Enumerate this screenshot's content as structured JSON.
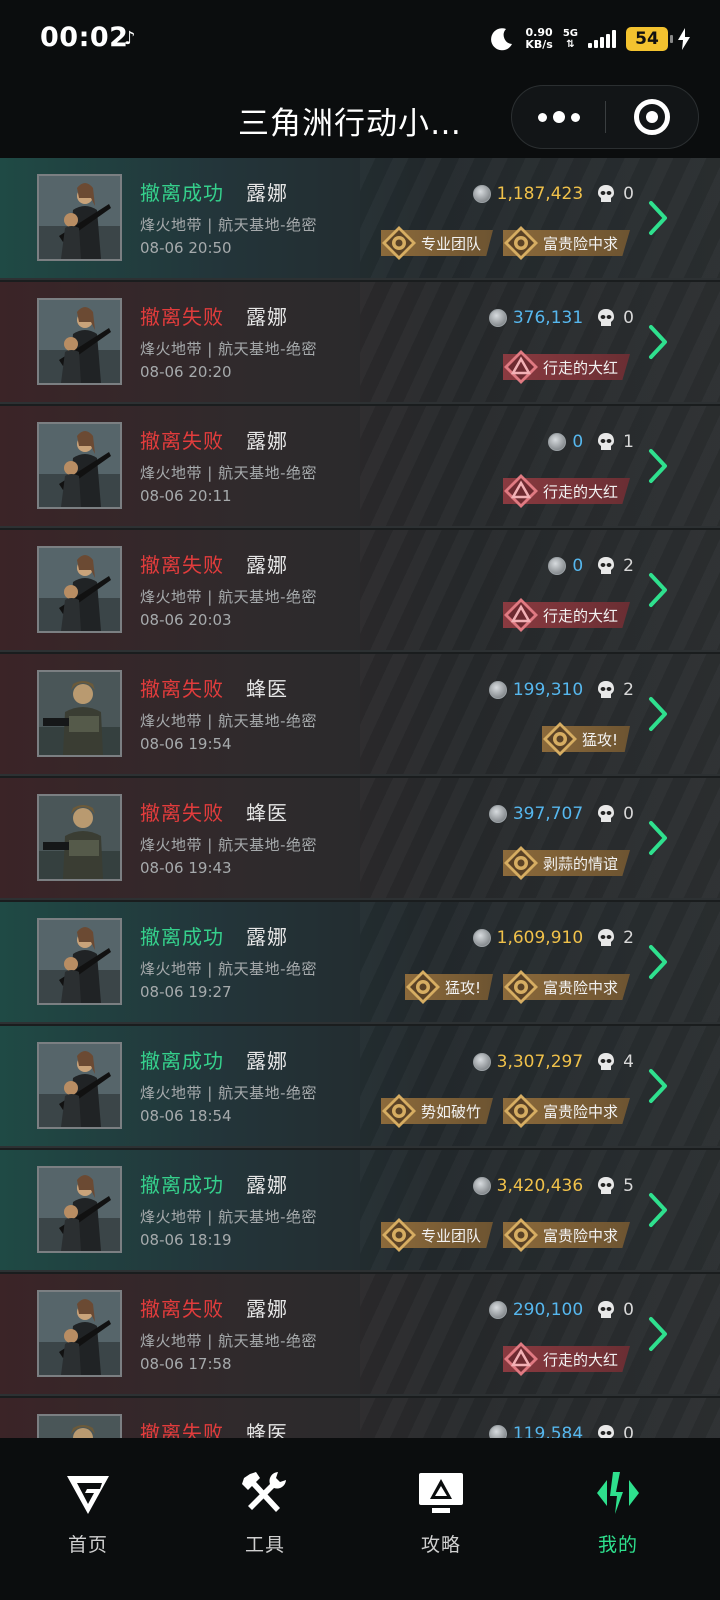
{
  "status_bar": {
    "time": "00:02",
    "speed_value": "0.90",
    "speed_unit": "KB/s",
    "network": "5G",
    "battery": "54"
  },
  "header": {
    "title": "三角洲行动小…"
  },
  "records": [
    {
      "result": "撤离成功",
      "result_type": "success",
      "character": "露娜",
      "avatar": "luna-avatar",
      "map": "烽火地带 | 航天基地-绝密",
      "time": "08-06 20:50",
      "value": "1,187,423",
      "value_color": "gold",
      "kills": "0",
      "tags": [
        {
          "label": "专业团队",
          "style": "gold"
        },
        {
          "label": "富贵险中求",
          "style": "gold"
        }
      ]
    },
    {
      "result": "撤离失败",
      "result_type": "fail",
      "character": "露娜",
      "avatar": "luna-avatar",
      "map": "烽火地带 | 航天基地-绝密",
      "time": "08-06 20:20",
      "value": "376,131",
      "value_color": "blue",
      "kills": "0",
      "tags": [
        {
          "label": "行走的大红",
          "style": "red"
        }
      ]
    },
    {
      "result": "撤离失败",
      "result_type": "fail",
      "character": "露娜",
      "avatar": "luna-avatar",
      "map": "烽火地带 | 航天基地-绝密",
      "time": "08-06 20:11",
      "value": "0",
      "value_color": "blue",
      "kills": "1",
      "tags": [
        {
          "label": "行走的大红",
          "style": "red"
        }
      ]
    },
    {
      "result": "撤离失败",
      "result_type": "fail",
      "character": "露娜",
      "avatar": "luna-avatar",
      "map": "烽火地带 | 航天基地-绝密",
      "time": "08-06 20:03",
      "value": "0",
      "value_color": "blue",
      "kills": "2",
      "tags": [
        {
          "label": "行走的大红",
          "style": "red"
        }
      ]
    },
    {
      "result": "撤离失败",
      "result_type": "fail",
      "character": "蜂医",
      "avatar": "medic-avatar",
      "map": "烽火地带 | 航天基地-绝密",
      "time": "08-06 19:54",
      "value": "199,310",
      "value_color": "blue",
      "kills": "2",
      "tags": [
        {
          "label": "猛攻!",
          "style": "gold"
        }
      ]
    },
    {
      "result": "撤离失败",
      "result_type": "fail",
      "character": "蜂医",
      "avatar": "medic-avatar",
      "map": "烽火地带 | 航天基地-绝密",
      "time": "08-06 19:43",
      "value": "397,707",
      "value_color": "blue",
      "kills": "0",
      "tags": [
        {
          "label": "剥蒜的情谊",
          "style": "gold"
        }
      ]
    },
    {
      "result": "撤离成功",
      "result_type": "success",
      "character": "露娜",
      "avatar": "luna-avatar",
      "map": "烽火地带 | 航天基地-绝密",
      "time": "08-06 19:27",
      "value": "1,609,910",
      "value_color": "gold",
      "kills": "2",
      "tags": [
        {
          "label": "猛攻!",
          "style": "gold"
        },
        {
          "label": "富贵险中求",
          "style": "gold"
        }
      ]
    },
    {
      "result": "撤离成功",
      "result_type": "success",
      "character": "露娜",
      "avatar": "luna-avatar",
      "map": "烽火地带 | 航天基地-绝密",
      "time": "08-06 18:54",
      "value": "3,307,297",
      "value_color": "gold",
      "kills": "4",
      "tags": [
        {
          "label": "势如破竹",
          "style": "gold"
        },
        {
          "label": "富贵险中求",
          "style": "gold"
        }
      ]
    },
    {
      "result": "撤离成功",
      "result_type": "success",
      "character": "露娜",
      "avatar": "luna-avatar",
      "map": "烽火地带 | 航天基地-绝密",
      "time": "08-06 18:19",
      "value": "3,420,436",
      "value_color": "gold",
      "kills": "5",
      "tags": [
        {
          "label": "专业团队",
          "style": "gold"
        },
        {
          "label": "富贵险中求",
          "style": "gold"
        }
      ]
    },
    {
      "result": "撤离失败",
      "result_type": "fail",
      "character": "露娜",
      "avatar": "luna-avatar",
      "map": "烽火地带 | 航天基地-绝密",
      "time": "08-06 17:58",
      "value": "290,100",
      "value_color": "blue",
      "kills": "0",
      "tags": [
        {
          "label": "行走的大红",
          "style": "red"
        }
      ]
    },
    {
      "result": "撤离失败",
      "result_type": "fail",
      "character": "蜂医",
      "avatar": "medic-avatar",
      "map": "",
      "time": "",
      "value": "119,584",
      "value_color": "blue",
      "kills": "0",
      "tags": []
    }
  ],
  "bottom_nav": [
    {
      "label": "首页",
      "icon": "home-logo-icon",
      "active": false
    },
    {
      "label": "工具",
      "icon": "tools-icon",
      "active": false
    },
    {
      "label": "攻略",
      "icon": "guide-monitor-icon",
      "active": false
    },
    {
      "label": "我的",
      "icon": "mine-logo-icon",
      "active": true
    }
  ],
  "colors": {
    "success": "#35d08c",
    "fail": "#e23c3c",
    "gold_value": "#f0c14a",
    "blue_value": "#56b7ee",
    "active_nav": "#2ee08d"
  }
}
